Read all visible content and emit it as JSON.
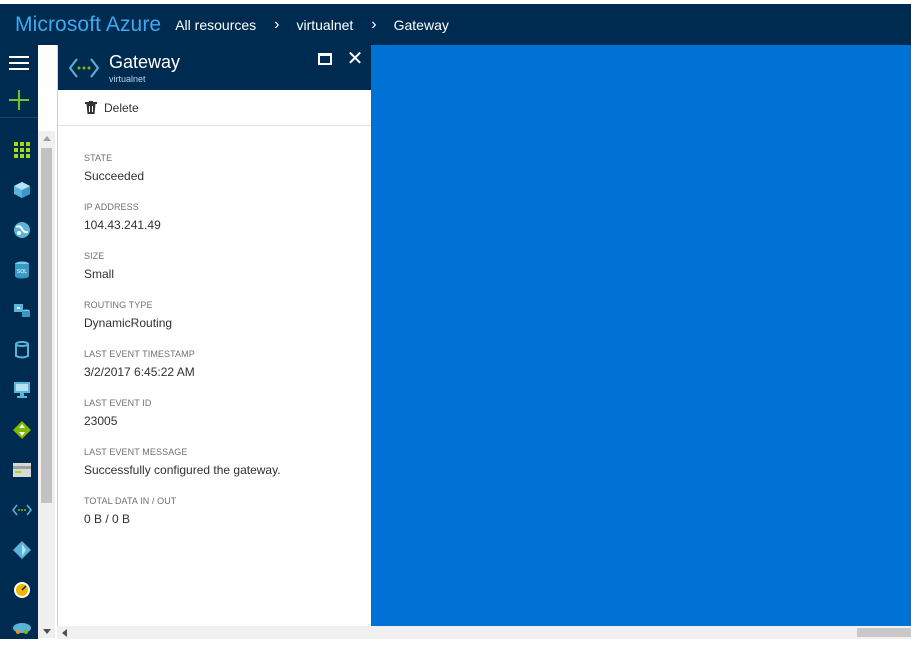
{
  "topbar": {
    "brand": "Microsoft Azure",
    "breadcrumbs": [
      "All resources",
      "virtualnet",
      "Gateway"
    ]
  },
  "sidebar": {
    "icons": [
      "hamburger-menu-icon",
      "new-plus-icon",
      "dashboard-grid-icon",
      "resource-groups-cube-icon",
      "app-services-globe-icon",
      "sql-databases-icon",
      "virtual-machines-classic-icon",
      "storage-cylinder-icon",
      "virtual-machines-monitor-icon",
      "load-balancers-icon",
      "storage-accounts-icon",
      "virtual-networks-icon",
      "azure-ad-icon",
      "monitor-gauge-icon",
      "cloud-services-icon"
    ],
    "colors": {
      "background": "#002b50",
      "plus": "#6bc72a",
      "grid": "#a4d91a"
    }
  },
  "blade": {
    "title": "Gateway",
    "subtitle": "virtualnet",
    "delete_label": "Delete",
    "properties": [
      {
        "label": "STATE",
        "value": "Succeeded"
      },
      {
        "label": "IP ADDRESS",
        "value": "104.43.241.49"
      },
      {
        "label": "SIZE",
        "value": "Small"
      },
      {
        "label": "ROUTING TYPE",
        "value": "DynamicRouting"
      },
      {
        "label": "LAST EVENT TIMESTAMP",
        "value": "3/2/2017 6:45:22 AM"
      },
      {
        "label": "LAST EVENT ID",
        "value": "23005"
      },
      {
        "label": "LAST EVENT MESSAGE",
        "value": "Successfully configured the gateway."
      },
      {
        "label": "TOTAL DATA IN / OUT",
        "value": "0 B / 0 B"
      }
    ]
  },
  "colors": {
    "header": "#002b50",
    "brand_text": "#3da9ef",
    "canvas": "#0072d6"
  }
}
